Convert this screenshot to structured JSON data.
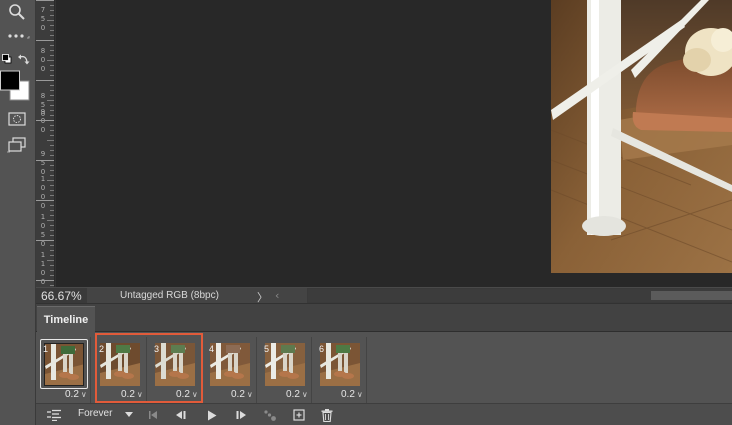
{
  "toolbar": {
    "tools": [
      {
        "name": "zoom-tool",
        "icon": "magnifier-icon"
      },
      {
        "name": "more-tools",
        "icon": "ellipsis-icon"
      },
      {
        "name": "default-colors",
        "icon": "default-colors-icon"
      },
      {
        "name": "swap-colors",
        "icon": "swap-arrow-icon"
      },
      {
        "name": "color-swatches",
        "icon": "fg-bg-swatch-icon"
      },
      {
        "name": "quick-mask",
        "icon": "quick-mask-icon"
      },
      {
        "name": "screen-mode",
        "icon": "screen-mode-icon"
      }
    ],
    "foreground_color": "#000000",
    "background_color": "#ffffff"
  },
  "ruler": {
    "labels": [
      {
        "digits": [
          "7",
          "5",
          "0"
        ]
      },
      {
        "digits": [
          "8",
          "0",
          "0"
        ]
      },
      {
        "digits": [
          "8",
          "5",
          "0"
        ]
      },
      {
        "digits": [
          "9",
          "0",
          "0"
        ]
      },
      {
        "digits": [
          "9",
          "5",
          "0"
        ]
      },
      {
        "digits": [
          "1",
          "0",
          "0",
          "0"
        ]
      },
      {
        "digits": [
          "1",
          "0",
          "5",
          "0"
        ]
      },
      {
        "digits": [
          "1",
          "1",
          "0",
          "0"
        ]
      }
    ]
  },
  "status": {
    "zoom": "66.67%",
    "doc_info": "Untagged RGB (8bpc)",
    "expand_arrow": "〉",
    "scroll_left_arrow": "‹"
  },
  "timeline": {
    "tab_label": "Timeline",
    "frames": [
      {
        "number": "1",
        "delay": "0.2",
        "selected": true
      },
      {
        "number": "2",
        "delay": "0.2",
        "selected": false
      },
      {
        "number": "3",
        "delay": "0.2",
        "selected": false
      },
      {
        "number": "4",
        "delay": "0.2",
        "selected": false
      },
      {
        "number": "5",
        "delay": "0.2",
        "selected": false
      },
      {
        "number": "6",
        "delay": "0.2",
        "selected": false
      }
    ],
    "delay_caret": "∨",
    "loop_option": "Forever",
    "highlight_color": "#e25b3a"
  },
  "colors": {
    "panel": "#535353",
    "canvas": "#282828",
    "highlight": "#e25b3a"
  }
}
